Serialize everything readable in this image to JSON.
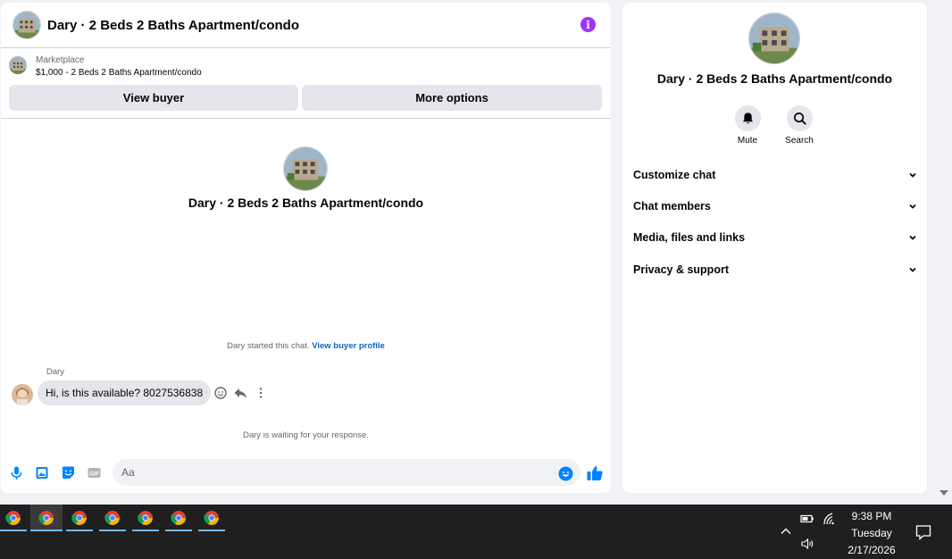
{
  "chat": {
    "title": "Dary · 2 Beds 2 Baths Apartment/condo",
    "info_icon": "info-icon",
    "listing": {
      "label": "Marketplace",
      "price_title": "$1,000 - 2 Beds 2 Baths Apartment/condo",
      "view_buyer": "View buyer",
      "more_options": "More options"
    },
    "conversation_title": "Dary · 2 Beds 2 Baths Apartment/condo",
    "started_text": "Dary started this chat.",
    "started_link": "View buyer profile",
    "message": {
      "sender": "Dary",
      "text": "Hi, is this available? 8027536838"
    },
    "waiting_text": "Dary is waiting for your response.",
    "composer": {
      "placeholder": "Aa"
    }
  },
  "details": {
    "title": "Dary · 2 Beds 2 Baths Apartment/condo",
    "actions": [
      {
        "label": "Mute",
        "icon": "bell-icon"
      },
      {
        "label": "Search",
        "icon": "search-icon"
      }
    ],
    "sections": [
      {
        "label": "Customize chat"
      },
      {
        "label": "Chat members"
      },
      {
        "label": "Media, files and links"
      },
      {
        "label": "Privacy & support"
      }
    ]
  },
  "taskbar": {
    "apps": [
      "chrome-icon",
      "chrome-icon",
      "chrome-icon",
      "chrome-icon",
      "chrome-icon",
      "chrome-icon",
      "chrome-icon"
    ],
    "clock": {
      "time": "9:38 PM",
      "day": "Tuesday",
      "date": "2/17/2026"
    }
  },
  "colors": {
    "accent": "#0a66c2",
    "messenger_blue": "#0084ff",
    "info_purple": "#a033ff",
    "bubble_gray": "#e4e6eb",
    "taskbar": "#1f1f1f"
  }
}
